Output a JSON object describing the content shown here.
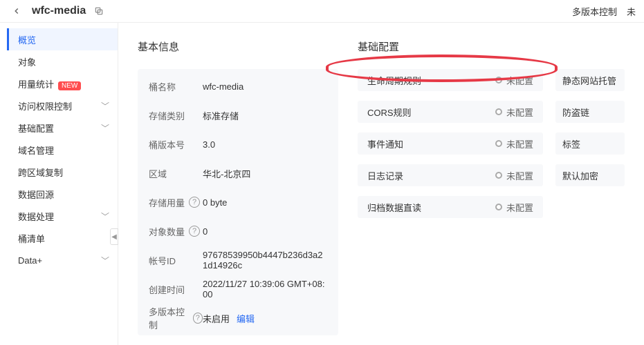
{
  "header": {
    "title": "wfc-media",
    "right_links": [
      "多版本控制",
      "未"
    ]
  },
  "sidebar": {
    "items": [
      {
        "label": "概览",
        "active": true
      },
      {
        "label": "对象"
      },
      {
        "label": "用量统计",
        "badge": "NEW"
      },
      {
        "label": "访问权限控制",
        "expandable": true
      },
      {
        "label": "基础配置",
        "expandable": true
      },
      {
        "label": "域名管理"
      },
      {
        "label": "跨区域复制"
      },
      {
        "label": "数据回源"
      },
      {
        "label": "数据处理",
        "expandable": true
      },
      {
        "label": "桶清单"
      },
      {
        "label": "Data+",
        "expandable": true
      }
    ]
  },
  "basic_info": {
    "title": "基本信息",
    "rows": [
      {
        "label": "桶名称",
        "value": "wfc-media"
      },
      {
        "label": "存储类别",
        "value": "标准存储"
      },
      {
        "label": "桶版本号",
        "value": "3.0"
      },
      {
        "label": "区域",
        "value": "华北-北京四"
      },
      {
        "label": "存储用量",
        "value": "0 byte",
        "help": true
      },
      {
        "label": "对象数量",
        "value": "0",
        "help": true
      },
      {
        "label": "帐号ID",
        "value": "97678539950b4447b236d3a21d14926c"
      },
      {
        "label": "创建时间",
        "value": "2022/11/27 10:39:06 GMT+08:00"
      },
      {
        "label": "多版本控制",
        "value": "未启用",
        "help": true,
        "action": "编辑"
      }
    ]
  },
  "basic_config": {
    "title": "基础配置",
    "status_label": "未配置",
    "left_items": [
      {
        "label": "生命周期规则"
      },
      {
        "label": "CORS规则"
      },
      {
        "label": "事件通知"
      },
      {
        "label": "日志记录"
      },
      {
        "label": "归档数据直读"
      }
    ],
    "right_items": [
      {
        "label": "静态网站托管"
      },
      {
        "label": "防盗链"
      },
      {
        "label": "标签"
      },
      {
        "label": "默认加密"
      }
    ]
  }
}
